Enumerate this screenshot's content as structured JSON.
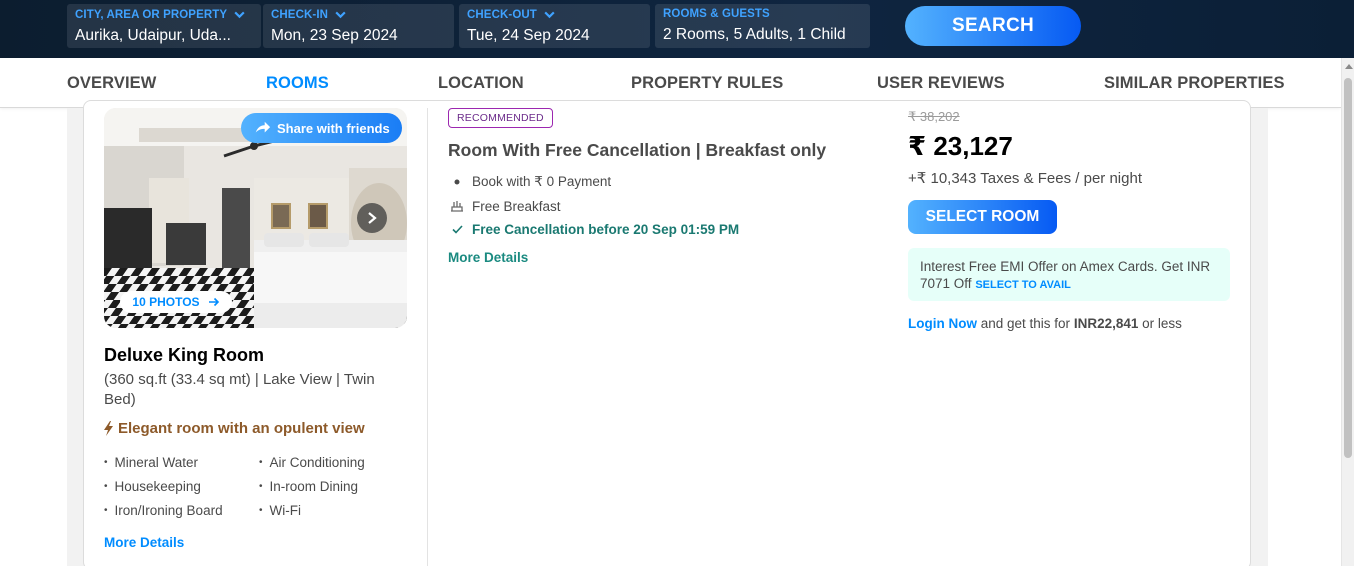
{
  "search": {
    "city_label": "CITY, AREA OR PROPERTY",
    "city_value": "Aurika, Udaipur, Uda...",
    "checkin_label": "CHECK-IN",
    "checkin_value": "Mon, 23 Sep 2024",
    "checkout_label": "CHECK-OUT",
    "checkout_value": "Tue, 24 Sep 2024",
    "guests_label": "ROOMS & GUESTS",
    "guests_value": "2 Rooms, 5 Adults, 1 Child",
    "search_button": "SEARCH"
  },
  "tabs": [
    {
      "label": "OVERVIEW",
      "active": false
    },
    {
      "label": "ROOMS",
      "active": true
    },
    {
      "label": "LOCATION",
      "active": false
    },
    {
      "label": "PROPERTY RULES",
      "active": false
    },
    {
      "label": "USER REVIEWS",
      "active": false
    },
    {
      "label": "SIMILAR PROPERTIES",
      "active": false
    }
  ],
  "room": {
    "share_label": "Share with friends",
    "photos_label": "10 PHOTOS",
    "name": "Deluxe King Room",
    "description": "(360 sq.ft (33.4 sq mt) | Lake View | Twin Bed)",
    "highlight": "Elegant room with an opulent view",
    "amenities": [
      "Mineral Water",
      "Air Conditioning",
      "Housekeeping",
      "In-room Dining",
      "Iron/Ironing Board",
      "Wi-Fi"
    ],
    "more_details": "More Details"
  },
  "plan": {
    "badge": "RECOMMENDED",
    "title": "Room With Free Cancellation | Breakfast only",
    "inclusions": [
      {
        "icon": "bullet-icon",
        "text": "Book with ₹ 0 Payment",
        "style": "normal"
      },
      {
        "icon": "breakfast-icon",
        "text": "Free Breakfast",
        "style": "normal"
      },
      {
        "icon": "check-icon",
        "text": "Free Cancellation before 20 Sep 01:59 PM",
        "style": "green"
      }
    ],
    "more_details": "More Details"
  },
  "price": {
    "original": "₹ 38,202",
    "current": "₹ 23,127",
    "taxes": "+₹ 10,343 Taxes & Fees / per night",
    "select_button": "SELECT ROOM",
    "emi_text": "Interest Free EMI Offer on Amex Cards. Get INR 7071 Off",
    "emi_link": "SELECT TO AVAIL",
    "login_link": "Login Now",
    "login_text": "and get this for",
    "login_amount": "INR22,841",
    "login_suffix": "or less"
  },
  "colors": {
    "accent_blue": "#008cff",
    "header_bg": "#0c1d2f",
    "highlight_brown": "#8d5a2a",
    "cancellation_green": "#1a7971",
    "emi_bg": "#e6fff9",
    "badge_purple": "#9c27b0"
  }
}
